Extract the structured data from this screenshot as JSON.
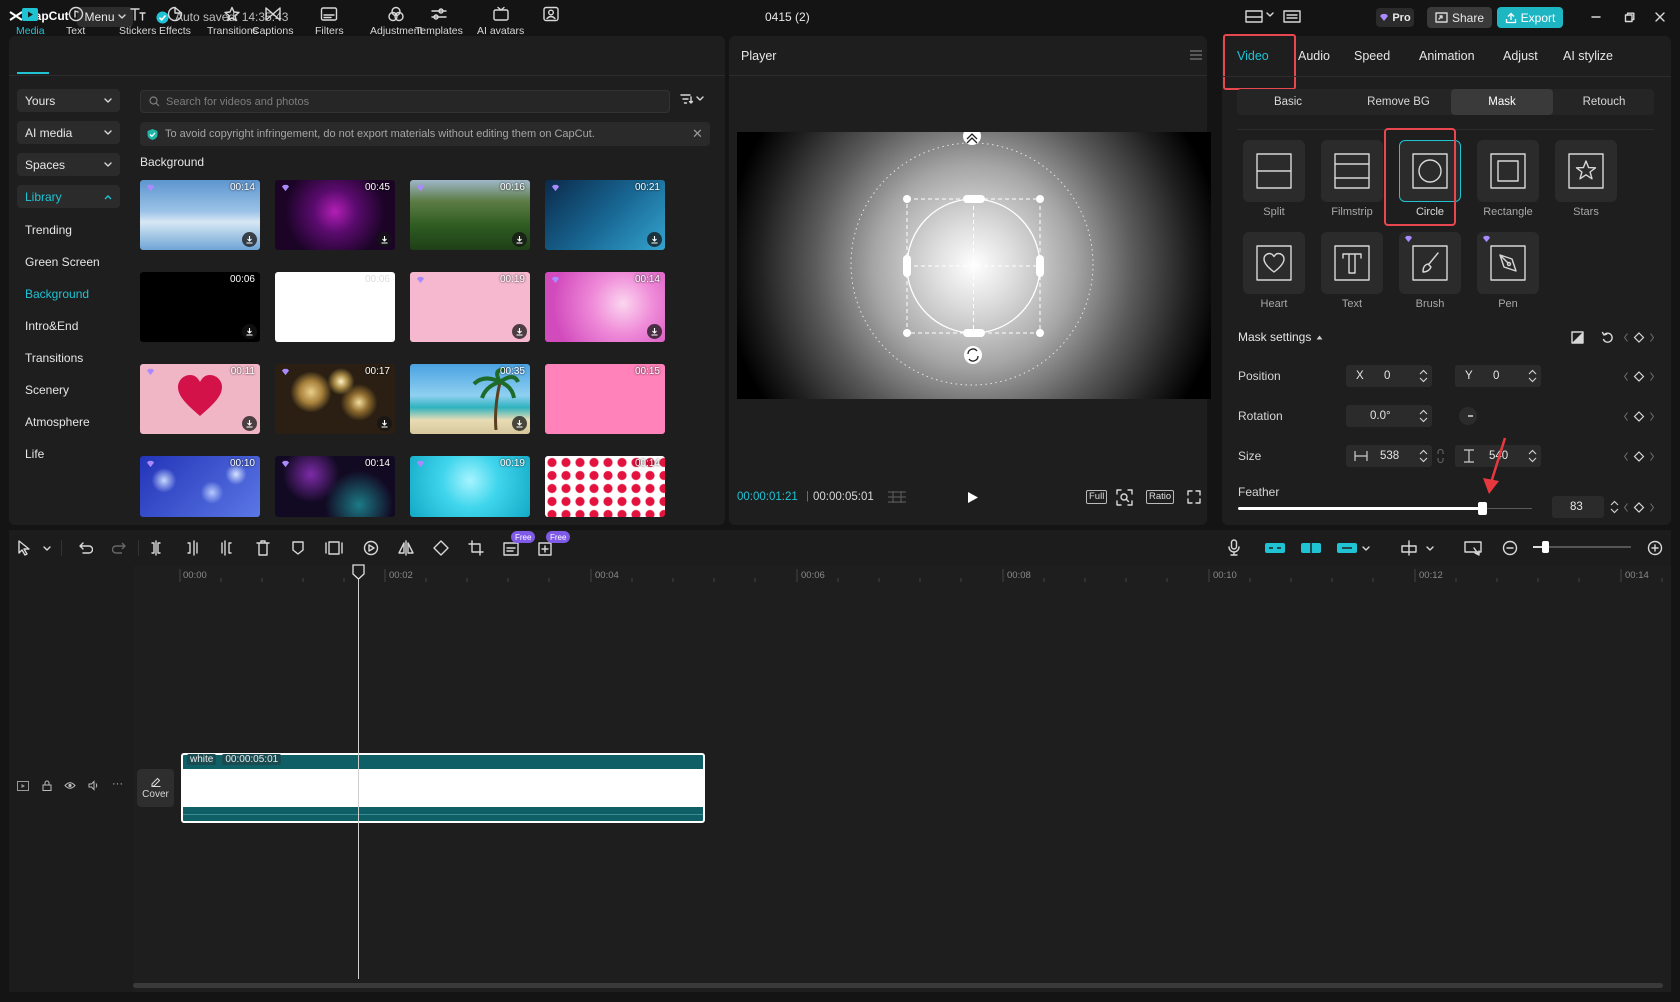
{
  "app": {
    "logo_text": "CapCut",
    "menu_label": "Menu",
    "autosave_text": "Auto saved: 14:35:43",
    "project_title": "0415 (2)",
    "pro_label": "Pro",
    "share_label": "Share",
    "export_label": "Export",
    "accent_color": "#1fc3d4",
    "highlight_color": "#e8474f"
  },
  "media_toolbar": [
    {
      "label": "Media",
      "icon": "media-icon"
    },
    {
      "label": "Text",
      "icon": "text-icon"
    },
    {
      "label": "Stickers",
      "icon": "stickers-icon"
    },
    {
      "label": "Effects",
      "icon": "effects-icon"
    },
    {
      "label": "Transitions",
      "icon": "transitions-icon"
    },
    {
      "label": "Captions",
      "icon": "captions-icon"
    },
    {
      "label": "Filters",
      "icon": "filters-icon"
    },
    {
      "label": "Adjustment",
      "icon": "adjustment-icon"
    },
    {
      "label": "Templates",
      "icon": "templates-icon"
    },
    {
      "label": "AI avatars",
      "icon": "ai-avatars-icon"
    }
  ],
  "sidebar": {
    "dropdowns": [
      "Yours",
      "AI media",
      "Spaces",
      "Library"
    ],
    "items": [
      "Trending",
      "Green Screen",
      "Background",
      "Intro&End",
      "Transitions",
      "Scenery",
      "Atmosphere",
      "Life"
    ],
    "active_item": "Background"
  },
  "library": {
    "search_placeholder": "Search for videos and photos",
    "notice": "To avoid copyright infringement, do not export materials without editing them on CapCut.",
    "section_title": "Background",
    "thumbnails": [
      {
        "duration": "00:14",
        "name": "sky-clouds"
      },
      {
        "duration": "00:45",
        "name": "purple-heart-particles"
      },
      {
        "duration": "00:16",
        "name": "forest-aerial"
      },
      {
        "duration": "00:21",
        "name": "blue-gradient"
      },
      {
        "duration": "00:06",
        "name": "black"
      },
      {
        "duration": "00:06",
        "name": "white"
      },
      {
        "duration": "00:19",
        "name": "pink-plain"
      },
      {
        "duration": "00:14",
        "name": "pink-hearts-bokeh"
      },
      {
        "duration": "00:11",
        "name": "pink-heart"
      },
      {
        "duration": "00:17",
        "name": "golden-bokeh"
      },
      {
        "duration": "00:35",
        "name": "beach-palm"
      },
      {
        "duration": "00:15",
        "name": "hot-pink"
      },
      {
        "duration": "00:10",
        "name": "blue-bokeh"
      },
      {
        "duration": "00:14",
        "name": "purple-particles"
      },
      {
        "duration": "00:19",
        "name": "cyan-hearts"
      },
      {
        "duration": "00:14",
        "name": "red-hearts-pattern"
      }
    ]
  },
  "player": {
    "title": "Player",
    "current_time": "00:00:01:21",
    "total_time": "00:00:05:01",
    "controls": [
      "Full",
      "Ratio"
    ]
  },
  "inspector": {
    "tabs": [
      "Video",
      "Audio",
      "Speed",
      "Animation",
      "Adjust",
      "AI stylize"
    ],
    "active_tab": "Video",
    "subtabs": [
      "Basic",
      "Remove BG",
      "Mask",
      "Retouch"
    ],
    "active_subtab": "Mask",
    "masks": [
      {
        "label": "Split",
        "icon": "split-mask-icon"
      },
      {
        "label": "Filmstrip",
        "icon": "filmstrip-mask-icon"
      },
      {
        "label": "Circle",
        "icon": "circle-mask-icon"
      },
      {
        "label": "Rectangle",
        "icon": "rectangle-mask-icon"
      },
      {
        "label": "Stars",
        "icon": "stars-mask-icon"
      },
      {
        "label": "Heart",
        "icon": "heart-mask-icon"
      },
      {
        "label": "Text",
        "icon": "text-mask-icon"
      },
      {
        "label": "Brush",
        "icon": "brush-mask-icon"
      },
      {
        "label": "Pen",
        "icon": "pen-mask-icon"
      }
    ],
    "active_mask": "Circle",
    "mask_settings_title": "Mask settings",
    "position_label": "Position",
    "position_x_label": "X",
    "position_x": "0",
    "position_y_label": "Y",
    "position_y": "0",
    "rotation_label": "Rotation",
    "rotation": "0.0°",
    "size_label": "Size",
    "size_w": "538",
    "size_h": "540",
    "feather_label": "Feather",
    "feather": "83",
    "feather_fraction": 0.83
  },
  "timeline": {
    "ticks": [
      "00:00",
      "00:02",
      "00:04",
      "00:06",
      "00:08",
      "00:10",
      "00:12",
      "00:14"
    ],
    "clip_name": "white",
    "clip_duration": "00:00:05:01",
    "cover_label": "Cover",
    "free_badge": "Free"
  }
}
